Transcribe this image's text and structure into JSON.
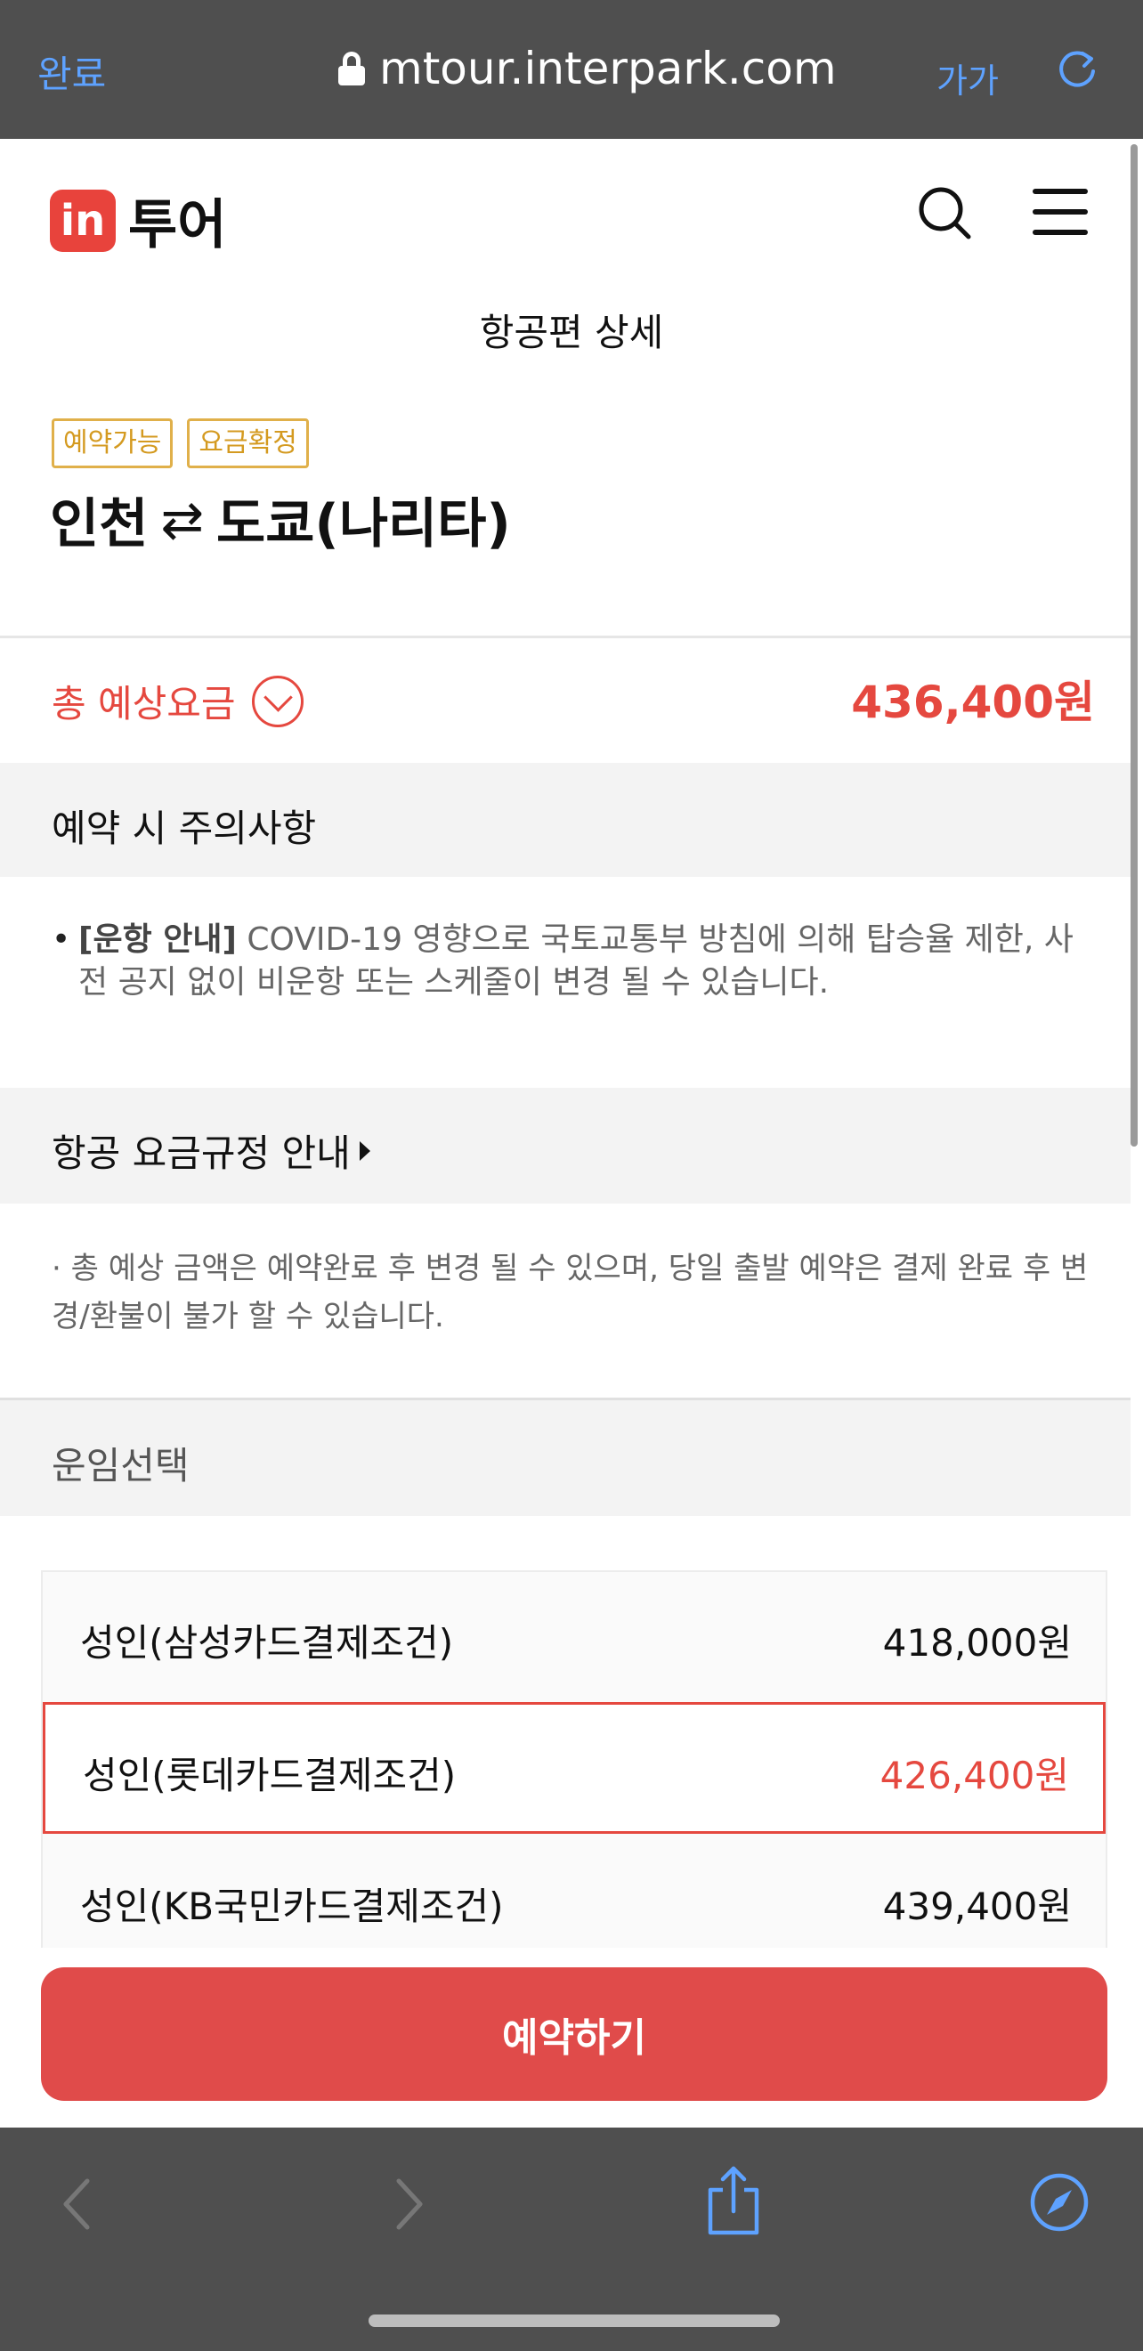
{
  "browser": {
    "done_label": "완료",
    "url": "mtour.interpark.com",
    "text_size_label": "가가",
    "icons": [
      "lock-icon",
      "reload-icon",
      "back-icon",
      "forward-icon",
      "share-icon",
      "compass-icon"
    ]
  },
  "header": {
    "logo_badge": "in",
    "logo_text": "투어",
    "page_title": "항공편 상세"
  },
  "flight": {
    "tags": [
      "예약가능",
      "요금확정"
    ],
    "origin": "인천",
    "arrow": "⇄",
    "destination": "도쿄(나리타)"
  },
  "total": {
    "label": "총 예상요금",
    "amount": "436,400원"
  },
  "notice": {
    "title": "예약 시 주의사항",
    "bullet": "•",
    "bold_prefix": "[운항 안내]",
    "text": " COVID-19 영향으로 국토교통부 방침에 의해 탑승율 제한, 사전 공지 없이 비운항 또는 스케줄이 변경 될 수 있습니다."
  },
  "fare_rules": {
    "title": "항공 요금규정 안내",
    "note": "· 총 예상 금액은 예약완료 후 변경 될 수 있으며, 당일 출발 예약은 결제 완료 후 변경/환불이 불가 할 수 있습니다."
  },
  "fare_select": {
    "title": "운임선택",
    "options": [
      {
        "name": "성인(삼성카드결제조건)",
        "price": "418,000원",
        "selected": false
      },
      {
        "name": "성인(롯데카드결제조건)",
        "price": "426,400원",
        "selected": true
      },
      {
        "name": "성인(KB국민카드결제조건)",
        "price": "439,400원",
        "selected": false
      }
    ]
  },
  "cta": {
    "book_label": "예약하기"
  },
  "colors": {
    "accent": "#e5483f",
    "tag": "#d49a20",
    "browser_bar": "#4f4f4f",
    "browser_link": "#5ea2ff"
  }
}
